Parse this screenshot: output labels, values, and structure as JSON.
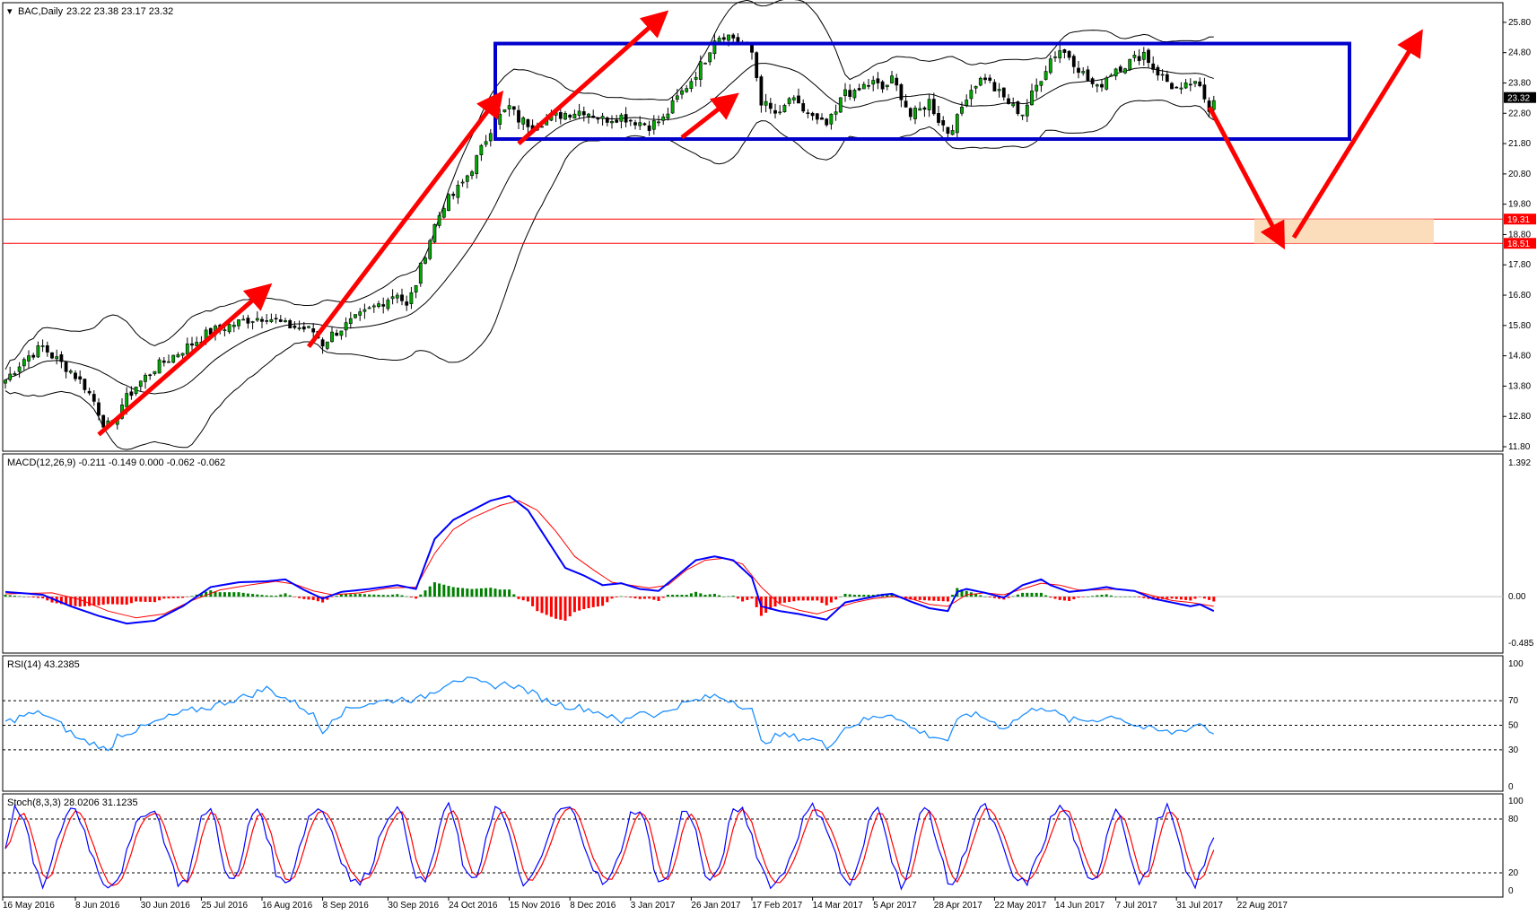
{
  "chart_data": {
    "type": "candlestick",
    "symbol_header": "BAC,Daily",
    "ohlc_header": "23.22 23.38 23.17 23.32",
    "price_panel": {
      "ylim": [
        11.8,
        26.3
      ],
      "y_ticks": [
        "25.80",
        "24.80",
        "23.80",
        "22.80",
        "21.80",
        "20.80",
        "19.80",
        "18.80",
        "17.80",
        "16.80",
        "15.80",
        "14.80",
        "13.80",
        "12.80",
        "11.80"
      ],
      "current_price": "23.32",
      "levels": [
        {
          "label": "19.31",
          "value": 19.31,
          "color": "#ff0000"
        },
        {
          "label": "18.51",
          "value": 18.51,
          "color": "#ff0000"
        }
      ],
      "range_box": {
        "top": 25.1,
        "bottom": 21.95,
        "color": "#0000cc"
      },
      "target_zone": {
        "top": 19.31,
        "bottom": 18.51,
        "color": "#fbd9b5"
      },
      "close_path": [
        [
          0,
          14.0
        ],
        [
          4,
          14.7
        ],
        [
          8,
          15.1
        ],
        [
          10,
          14.8
        ],
        [
          14,
          14.3
        ],
        [
          17,
          13.8
        ],
        [
          19,
          13.3
        ],
        [
          21,
          12.6
        ],
        [
          23,
          12.4
        ],
        [
          25,
          13.2
        ],
        [
          28,
          13.8
        ],
        [
          32,
          14.4
        ],
        [
          36,
          14.8
        ],
        [
          40,
          15.2
        ],
        [
          44,
          15.6
        ],
        [
          48,
          15.8
        ],
        [
          52,
          16.0
        ],
        [
          56,
          16.1
        ],
        [
          60,
          15.8
        ],
        [
          64,
          15.7
        ],
        [
          66,
          15.6
        ],
        [
          68,
          15.2
        ],
        [
          70,
          15.5
        ],
        [
          74,
          15.9
        ],
        [
          78,
          16.3
        ],
        [
          81,
          16.6
        ],
        [
          84,
          16.9
        ],
        [
          86,
          16.4
        ],
        [
          88,
          17.2
        ],
        [
          90,
          18.2
        ],
        [
          92,
          19.1
        ],
        [
          94,
          19.8
        ],
        [
          96,
          20.1
        ],
        [
          98,
          20.5
        ],
        [
          100,
          21.0
        ],
        [
          102,
          21.6
        ],
        [
          104,
          22.3
        ],
        [
          106,
          22.7
        ],
        [
          108,
          23.0
        ],
        [
          110,
          22.6
        ],
        [
          113,
          22.4
        ],
        [
          116,
          22.6
        ],
        [
          120,
          22.8
        ],
        [
          124,
          22.9
        ],
        [
          128,
          22.6
        ],
        [
          132,
          22.7
        ],
        [
          136,
          22.5
        ],
        [
          138,
          22.4
        ],
        [
          141,
          22.6
        ],
        [
          144,
          23.3
        ],
        [
          147,
          23.9
        ],
        [
          150,
          24.6
        ],
        [
          152,
          25.3
        ],
        [
          154,
          25.4
        ],
        [
          156,
          25.3
        ],
        [
          158,
          25.1
        ],
        [
          160,
          24.8
        ],
        [
          162,
          23.2
        ],
        [
          164,
          22.9
        ],
        [
          166,
          22.7
        ],
        [
          168,
          23.3
        ],
        [
          170,
          23.0
        ],
        [
          172,
          22.8
        ],
        [
          174,
          22.5
        ],
        [
          176,
          22.4
        ],
        [
          178,
          22.8
        ],
        [
          180,
          23.6
        ],
        [
          182,
          23.4
        ],
        [
          184,
          23.7
        ],
        [
          186,
          23.8
        ],
        [
          188,
          23.6
        ],
        [
          190,
          23.9
        ],
        [
          192,
          23.4
        ],
        [
          194,
          22.7
        ],
        [
          196,
          22.9
        ],
        [
          198,
          23.2
        ],
        [
          200,
          22.6
        ],
        [
          202,
          22.2
        ],
        [
          204,
          22.6
        ],
        [
          206,
          23.4
        ],
        [
          208,
          23.8
        ],
        [
          210,
          24.0
        ],
        [
          212,
          23.6
        ],
        [
          214,
          23.3
        ],
        [
          216,
          23.0
        ],
        [
          218,
          22.8
        ],
        [
          220,
          23.4
        ],
        [
          222,
          24.0
        ],
        [
          224,
          24.6
        ],
        [
          226,
          24.9
        ],
        [
          228,
          24.7
        ],
        [
          230,
          24.3
        ],
        [
          232,
          23.9
        ],
        [
          234,
          23.6
        ],
        [
          236,
          24.0
        ],
        [
          238,
          24.3
        ],
        [
          240,
          24.4
        ],
        [
          242,
          24.6
        ],
        [
          244,
          24.8
        ],
        [
          246,
          24.3
        ],
        [
          248,
          24.0
        ],
        [
          250,
          23.7
        ],
        [
          252,
          23.5
        ],
        [
          254,
          23.8
        ],
        [
          256,
          23.6
        ],
        [
          258,
          23.0
        ],
        [
          259,
          23.32
        ]
      ],
      "bars": 260
    },
    "macd_panel": {
      "label": "MACD(12,26,9) -0.211 -0.149 0.000 -0.062 -0.062",
      "ylim": [
        -0.55,
        1.45
      ],
      "y_ticks": [
        "1.392",
        "0.00",
        "-0.485"
      ],
      "macd_line_color": "#0000ff",
      "signal_line_color": "#ff0000",
      "hist_up_color": "#008000",
      "hist_down_color": "#ff0000",
      "macd_path": [
        [
          0,
          0.05
        ],
        [
          8,
          0.02
        ],
        [
          14,
          -0.1
        ],
        [
          20,
          -0.2
        ],
        [
          26,
          -0.28
        ],
        [
          32,
          -0.25
        ],
        [
          38,
          -0.1
        ],
        [
          44,
          0.1
        ],
        [
          50,
          0.15
        ],
        [
          56,
          0.16
        ],
        [
          60,
          0.18
        ],
        [
          64,
          0.07
        ],
        [
          68,
          -0.02
        ],
        [
          72,
          0.05
        ],
        [
          78,
          0.08
        ],
        [
          84,
          0.12
        ],
        [
          88,
          0.08
        ],
        [
          92,
          0.6
        ],
        [
          96,
          0.8
        ],
        [
          100,
          0.9
        ],
        [
          104,
          1.0
        ],
        [
          108,
          1.05
        ],
        [
          112,
          0.9
        ],
        [
          116,
          0.6
        ],
        [
          120,
          0.3
        ],
        [
          124,
          0.22
        ],
        [
          128,
          0.12
        ],
        [
          132,
          0.14
        ],
        [
          136,
          0.08
        ],
        [
          140,
          0.06
        ],
        [
          144,
          0.22
        ],
        [
          148,
          0.38
        ],
        [
          152,
          0.42
        ],
        [
          156,
          0.38
        ],
        [
          160,
          0.2
        ],
        [
          162,
          -0.1
        ],
        [
          166,
          -0.15
        ],
        [
          170,
          -0.18
        ],
        [
          174,
          -0.22
        ],
        [
          176,
          -0.24
        ],
        [
          180,
          -0.06
        ],
        [
          184,
          -0.02
        ],
        [
          188,
          0.02
        ],
        [
          190,
          0.03
        ],
        [
          194,
          -0.05
        ],
        [
          198,
          -0.12
        ],
        [
          202,
          -0.15
        ],
        [
          204,
          0.05
        ],
        [
          206,
          0.08
        ],
        [
          210,
          0.04
        ],
        [
          214,
          -0.01
        ],
        [
          218,
          0.12
        ],
        [
          222,
          0.18
        ],
        [
          224,
          0.12
        ],
        [
          228,
          0.05
        ],
        [
          232,
          0.07
        ],
        [
          236,
          0.1
        ],
        [
          238,
          0.08
        ],
        [
          242,
          0.06
        ],
        [
          246,
          -0.02
        ],
        [
          250,
          -0.06
        ],
        [
          254,
          -0.1
        ],
        [
          256,
          -0.08
        ],
        [
          259,
          -0.15
        ]
      ],
      "signal_path": [
        [
          0,
          0.03
        ],
        [
          10,
          0.04
        ],
        [
          16,
          -0.03
        ],
        [
          22,
          -0.15
        ],
        [
          28,
          -0.22
        ],
        [
          34,
          -0.18
        ],
        [
          40,
          -0.04
        ],
        [
          46,
          0.07
        ],
        [
          52,
          0.12
        ],
        [
          58,
          0.16
        ],
        [
          62,
          0.13
        ],
        [
          66,
          0.06
        ],
        [
          70,
          0.02
        ],
        [
          76,
          0.04
        ],
        [
          82,
          0.09
        ],
        [
          88,
          0.1
        ],
        [
          92,
          0.45
        ],
        [
          96,
          0.7
        ],
        [
          100,
          0.82
        ],
        [
          106,
          0.95
        ],
        [
          110,
          1.0
        ],
        [
          114,
          0.9
        ],
        [
          118,
          0.68
        ],
        [
          122,
          0.42
        ],
        [
          126,
          0.28
        ],
        [
          130,
          0.15
        ],
        [
          134,
          0.12
        ],
        [
          138,
          0.09
        ],
        [
          142,
          0.12
        ],
        [
          146,
          0.28
        ],
        [
          150,
          0.38
        ],
        [
          154,
          0.4
        ],
        [
          158,
          0.34
        ],
        [
          162,
          0.1
        ],
        [
          166,
          -0.08
        ],
        [
          170,
          -0.14
        ],
        [
          174,
          -0.18
        ],
        [
          178,
          -0.12
        ],
        [
          182,
          -0.06
        ],
        [
          186,
          -0.02
        ],
        [
          190,
          0.0
        ],
        [
          194,
          -0.02
        ],
        [
          198,
          -0.08
        ],
        [
          202,
          -0.1
        ],
        [
          206,
          0.02
        ],
        [
          210,
          0.04
        ],
        [
          214,
          0.02
        ],
        [
          218,
          0.08
        ],
        [
          222,
          0.14
        ],
        [
          226,
          0.12
        ],
        [
          230,
          0.07
        ],
        [
          234,
          0.07
        ],
        [
          238,
          0.08
        ],
        [
          242,
          0.06
        ],
        [
          246,
          0.01
        ],
        [
          250,
          -0.04
        ],
        [
          254,
          -0.06
        ],
        [
          259,
          -0.1
        ]
      ]
    },
    "rsi_panel": {
      "label": "RSI(14) 43.2385",
      "ylim": [
        0,
        100
      ],
      "y_ticks": [
        "100",
        "70",
        "50",
        "30",
        "0"
      ],
      "levels": [
        70,
        50,
        30
      ],
      "line_color": "#1e90ff",
      "path": [
        [
          0,
          52
        ],
        [
          4,
          58
        ],
        [
          8,
          60
        ],
        [
          12,
          50
        ],
        [
          16,
          38
        ],
        [
          20,
          34
        ],
        [
          22,
          28
        ],
        [
          24,
          42
        ],
        [
          28,
          46
        ],
        [
          32,
          52
        ],
        [
          36,
          58
        ],
        [
          40,
          62
        ],
        [
          44,
          65
        ],
        [
          48,
          70
        ],
        [
          52,
          74
        ],
        [
          56,
          80
        ],
        [
          60,
          72
        ],
        [
          64,
          64
        ],
        [
          66,
          58
        ],
        [
          68,
          44
        ],
        [
          70,
          56
        ],
        [
          74,
          64
        ],
        [
          78,
          68
        ],
        [
          82,
          70
        ],
        [
          86,
          72
        ],
        [
          88,
          70
        ],
        [
          92,
          78
        ],
        [
          96,
          88
        ],
        [
          100,
          86
        ],
        [
          104,
          82
        ],
        [
          108,
          84
        ],
        [
          112,
          78
        ],
        [
          116,
          70
        ],
        [
          120,
          66
        ],
        [
          124,
          64
        ],
        [
          128,
          60
        ],
        [
          132,
          52
        ],
        [
          136,
          62
        ],
        [
          140,
          58
        ],
        [
          144,
          66
        ],
        [
          148,
          70
        ],
        [
          152,
          74
        ],
        [
          156,
          70
        ],
        [
          160,
          62
        ],
        [
          162,
          36
        ],
        [
          166,
          42
        ],
        [
          170,
          40
        ],
        [
          174,
          38
        ],
        [
          176,
          32
        ],
        [
          180,
          48
        ],
        [
          184,
          54
        ],
        [
          188,
          58
        ],
        [
          190,
          60
        ],
        [
          194,
          48
        ],
        [
          198,
          42
        ],
        [
          202,
          38
        ],
        [
          204,
          52
        ],
        [
          206,
          60
        ],
        [
          210,
          56
        ],
        [
          214,
          48
        ],
        [
          218,
          58
        ],
        [
          222,
          66
        ],
        [
          224,
          62
        ],
        [
          228,
          54
        ],
        [
          232,
          54
        ],
        [
          236,
          56
        ],
        [
          238,
          58
        ],
        [
          242,
          50
        ],
        [
          246,
          46
        ],
        [
          250,
          44
        ],
        [
          254,
          48
        ],
        [
          256,
          52
        ],
        [
          259,
          43
        ]
      ]
    },
    "stoch_panel": {
      "label": "Stoch(8,3,3) 28.0206 31.1235",
      "ylim": [
        0,
        100
      ],
      "y_ticks": [
        "100",
        "80",
        "20",
        "0"
      ],
      "levels": [
        80,
        20
      ],
      "main_color": "#0000ff",
      "signal_color": "#ff0000",
      "period": 13
    },
    "x_ticks": [
      {
        "label": "16 May 2016",
        "bar": 0
      },
      {
        "label": "8 Jun 2016",
        "bar": 15
      },
      {
        "label": "30 Jun 2016",
        "bar": 29
      },
      {
        "label": "25 Jul 2016",
        "bar": 42
      },
      {
        "label": "16 Aug 2016",
        "bar": 55
      },
      {
        "label": "8 Sep 2016",
        "bar": 68
      },
      {
        "label": "30 Sep 2016",
        "bar": 82
      },
      {
        "label": "24 Oct 2016",
        "bar": 95
      },
      {
        "label": "15 Nov 2016",
        "bar": 108
      },
      {
        "label": "8 Dec 2016",
        "bar": 121
      },
      {
        "label": "3 Jan 2017",
        "bar": 134
      },
      {
        "label": "26 Jan 2017",
        "bar": 147
      },
      {
        "label": "17 Feb 2017",
        "bar": 160
      },
      {
        "label": "14 Mar 2017",
        "bar": 173
      },
      {
        "label": "5 Apr 2017",
        "bar": 186
      },
      {
        "label": "28 Apr 2017",
        "bar": 199
      },
      {
        "label": "22 May 2017",
        "bar": 212
      },
      {
        "label": "14 Jun 2017",
        "bar": 225
      },
      {
        "label": "7 Jul 2017",
        "bar": 238
      },
      {
        "label": "31 Jul 2017",
        "bar": 251
      },
      {
        "label": "22 Aug 2017",
        "bar": 264
      }
    ]
  }
}
